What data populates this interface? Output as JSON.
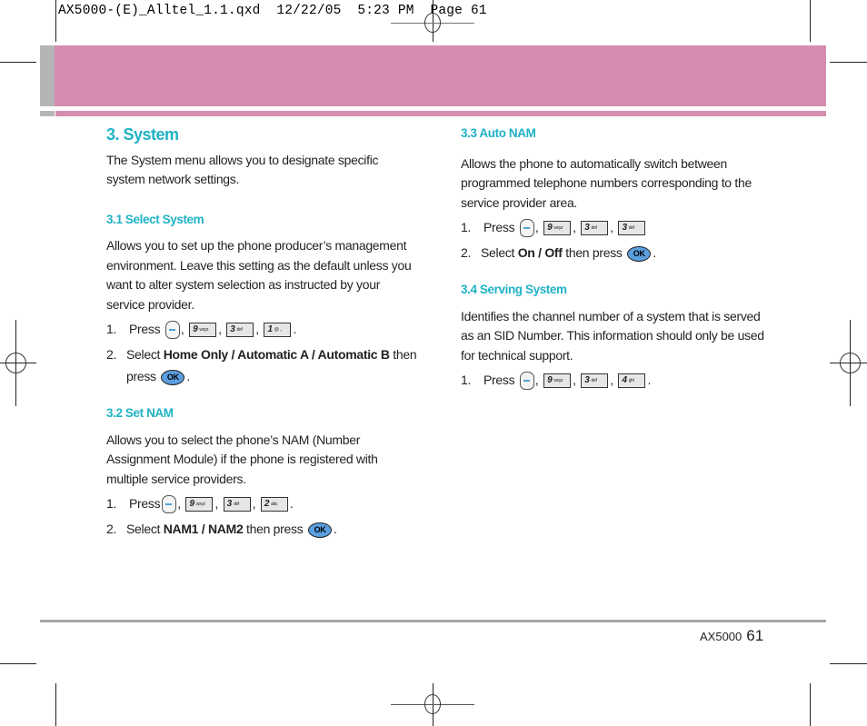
{
  "slug": "AX5000-(E)_Alltel_1.1.qxd  12/22/05  5:23 PM  Page 61",
  "colors": {
    "accent": "#1fb2c5",
    "banner": "#d48db1",
    "banner_side": "#b5b5b5",
    "rule": "#a7a7a7",
    "ok_key": "#5b9fe0"
  },
  "title": "3. System",
  "intro": "The System menu allows you to designate specific system network settings.",
  "sections": [
    {
      "heading": "3.1 Select System",
      "body": "Allows you to set up the phone producer’s management environment. Leave this setting as the default unless you want to alter system selection as instructed by your service provider.",
      "step1": {
        "num": "1.",
        "label": "Press",
        "keys": [
          {
            "d": "9",
            "s": "wxyz"
          },
          {
            "d": "3",
            "s": "def"
          },
          {
            "d": "1",
            "s": "@ .,"
          }
        ]
      },
      "step2": {
        "num": "2.",
        "pre": "Select ",
        "opt1": "Home Only",
        "sep1": " / ",
        "opt2": "Automatic A",
        "sep2": " / ",
        "opt3": "Automatic B",
        "post": " then press"
      }
    },
    {
      "heading": "3.2 Set NAM",
      "body": "Allows you to select the phone’s NAM (Number Assignment Module) if the phone is registered with multiple service providers.",
      "step1": {
        "num": "1.",
        "label": "Press",
        "keys": [
          {
            "d": "9",
            "s": "wxyz"
          },
          {
            "d": "3",
            "s": "def"
          },
          {
            "d": "2",
            "s": "abc"
          }
        ]
      },
      "step2": {
        "num": "2.",
        "pre": "Select ",
        "opt1": "NAM1",
        "sep1": " / ",
        "opt2": "NAM2",
        "post": " then press"
      }
    },
    {
      "heading": "3.3 Auto NAM",
      "body": "Allows the phone to automatically switch between programmed telephone numbers corresponding to the service provider area.",
      "step1": {
        "num": "1.",
        "label": "Press",
        "keys": [
          {
            "d": "9",
            "s": "wxyz"
          },
          {
            "d": "3",
            "s": "def"
          },
          {
            "d": "3",
            "s": "def"
          }
        ]
      },
      "step2": {
        "num": "2.",
        "pre": "Select ",
        "opt1": "On",
        "sep1": " / ",
        "opt2": "Off",
        "post": " then press"
      }
    },
    {
      "heading": "3.4 Serving System",
      "body": "Identifies the channel number of a system that is served as an SID Number. This information should only be used for technical support.",
      "step1": {
        "num": "1.",
        "label": "Press",
        "keys": [
          {
            "d": "9",
            "s": "wxyz"
          },
          {
            "d": "3",
            "s": "def"
          },
          {
            "d": "4",
            "s": "ghi"
          }
        ]
      }
    }
  ],
  "ok_label": "OK",
  "comma": ",",
  "period": ".",
  "footer": {
    "model": "AX5000",
    "page": "61"
  }
}
